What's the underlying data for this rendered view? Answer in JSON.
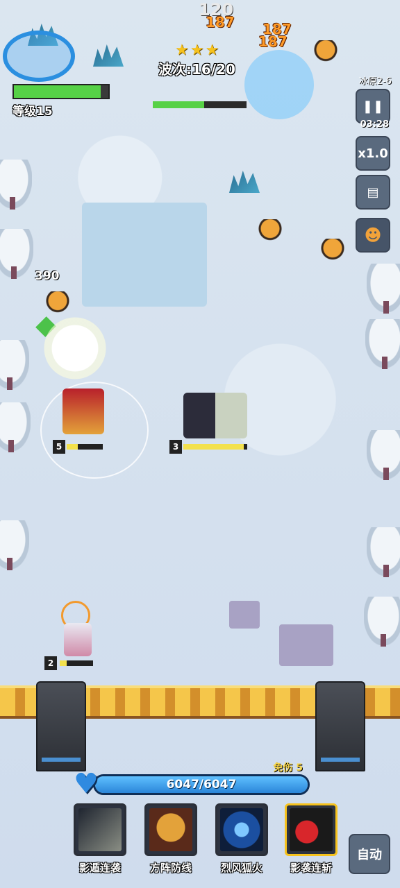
{
  "hud": {
    "level_label": "等级15",
    "level_progress": 0.92,
    "wave_label": "波次:16/20",
    "stars": "★★★",
    "wave_progress": 0.55,
    "stage": "冰原2-6",
    "timer": "03:28",
    "speed": "x1.0",
    "damage_numbers": [
      "187",
      "187",
      "187",
      "120"
    ]
  },
  "field": {
    "coin_amount": "390",
    "heroes": [
      {
        "level": "5",
        "hp": 0.3
      },
      {
        "level": "3",
        "hp": 0.95
      },
      {
        "level": "2",
        "hp": 0.2
      }
    ]
  },
  "base": {
    "hp_text": "6047/6047",
    "hp_fraction": 1.0,
    "shield_text": "免伤 5"
  },
  "skills": [
    {
      "label": "影遁连袭"
    },
    {
      "label": "方阵防线"
    },
    {
      "label": "烈风狐火"
    },
    {
      "label": "影袭连斩"
    }
  ],
  "auto_label": "自动",
  "colors": {
    "level_fill": "#56d146",
    "base_fill": "#2b86d9",
    "damage": "#ff9b28",
    "star": "#f6c21d"
  }
}
